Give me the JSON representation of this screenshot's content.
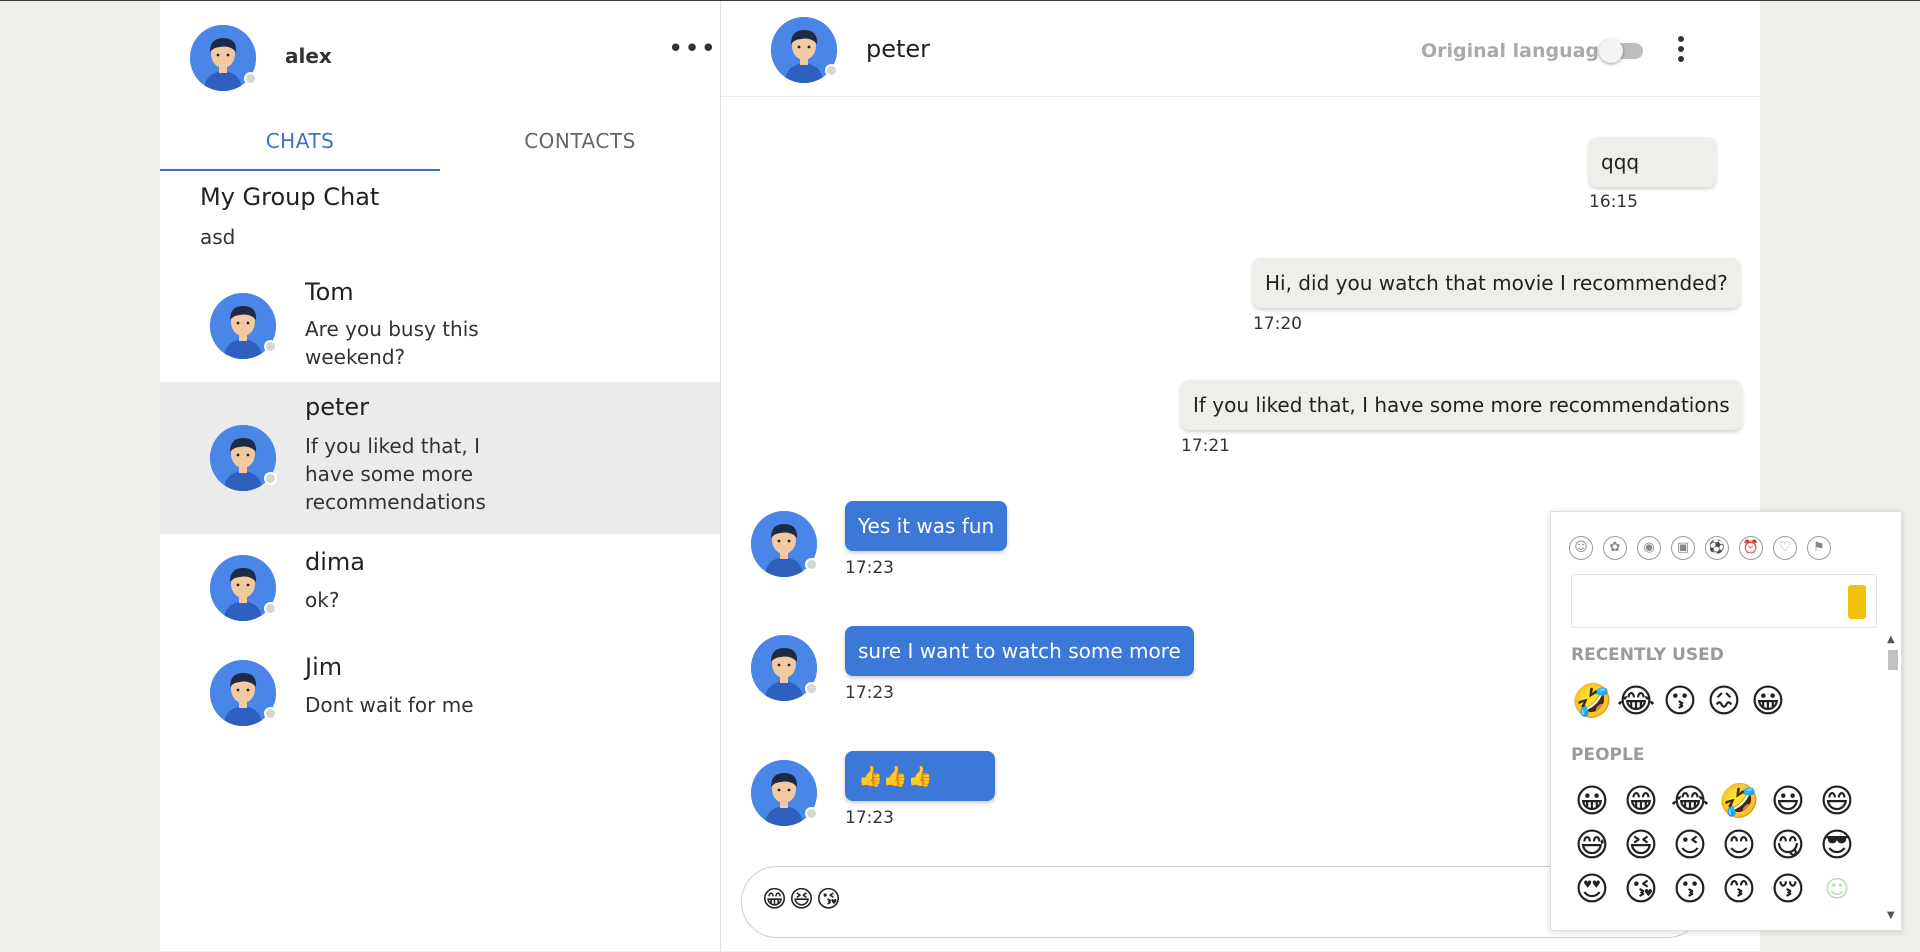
{
  "user": {
    "name": "alex"
  },
  "tabs": [
    "CHATS",
    "CONTACTS"
  ],
  "group": {
    "title": "My Group Chat",
    "last_message": "asd"
  },
  "chats": [
    {
      "name": "Tom",
      "preview": "Are you busy this weekend?"
    },
    {
      "name": "peter",
      "preview": "If you liked that, I have some more recommendations"
    },
    {
      "name": "dima",
      "preview": "ok?"
    },
    {
      "name": "Jim",
      "preview": "Dont wait for me"
    }
  ],
  "conversation": {
    "peer_name": "peter",
    "language_toggle_label": "Original language",
    "outgoing": [
      {
        "text": "qqq",
        "time": "16:15"
      },
      {
        "text": "Hi, did you watch that movie I recommended?",
        "time": "17:20"
      },
      {
        "text": "If you liked that, I have some more recommendations",
        "time": "17:21"
      }
    ],
    "incoming": [
      {
        "text": "Yes it was fun",
        "time": "17:23"
      },
      {
        "text": "sure I want to watch some more",
        "time": "17:23"
      },
      {
        "text": "👍👍👍",
        "time": "17:23"
      }
    ],
    "composer_value": "😁😆😘"
  },
  "emoji_picker": {
    "recent_label": "RECENTLY USED",
    "people_label": "PEOPLE",
    "recent": [
      "🤣",
      "😂",
      "😗",
      "😖",
      "😀"
    ],
    "people": [
      "😀",
      "😁",
      "😂",
      "🤣",
      "😃",
      "😄",
      "😅",
      "😆",
      "😉",
      "😊",
      "😋",
      "😎",
      "😍",
      "😘",
      "😗",
      "😙",
      "😚",
      "☺"
    ],
    "category_icons": [
      "people-icon",
      "nature-icon",
      "food-icon",
      "travel-icon",
      "activity-icon",
      "objects-icon",
      "symbols-icon",
      "flags-icon"
    ]
  },
  "colors": {
    "accent": "#3a74c8",
    "incoming_bubble": "#3c78d8",
    "outgoing_bubble": "#f0eeea",
    "avatar_bg": "#4a86e8"
  }
}
